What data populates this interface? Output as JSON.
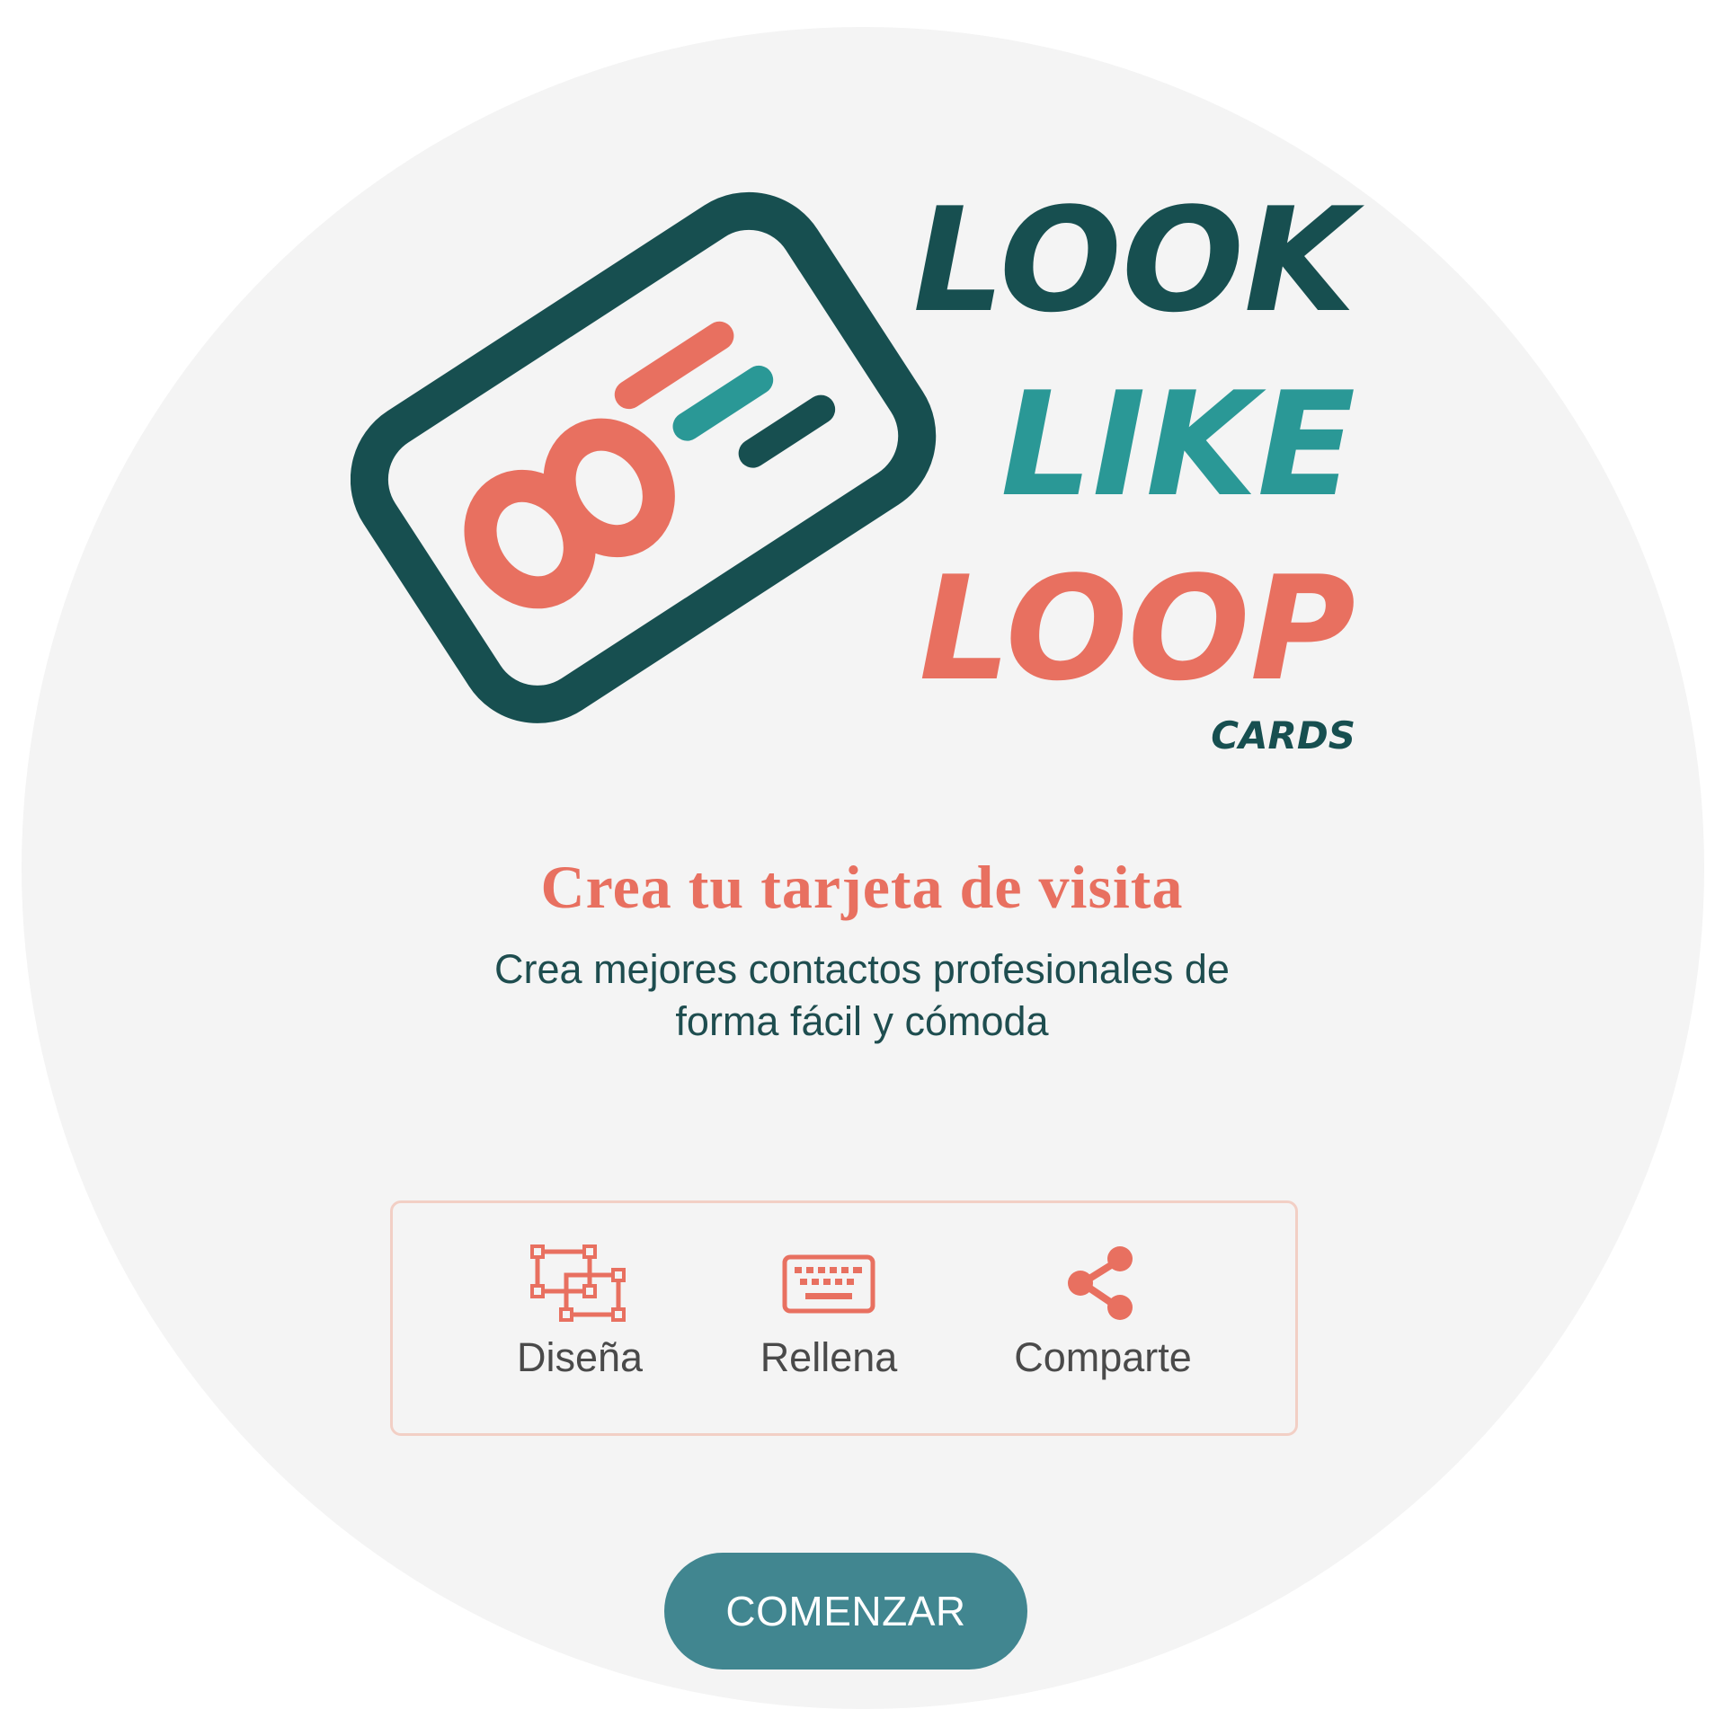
{
  "brand": {
    "logo_words": [
      "LOOK",
      "LIKE",
      "LOOP"
    ],
    "logo_tagline": "CARDS",
    "colors": {
      "dark_teal": "#174f50",
      "teal": "#2a9896",
      "coral": "#e87060"
    }
  },
  "hero": {
    "title": "Crea tu tarjeta de visita",
    "subtitle_line1": "Crea mejores contactos profesionales de",
    "subtitle_line2": "forma fácil y cómoda"
  },
  "steps": [
    {
      "icon": "design-selection-icon",
      "label": "Diseña"
    },
    {
      "icon": "keyboard-icon",
      "label": "Rellena"
    },
    {
      "icon": "share-icon",
      "label": "Comparte"
    }
  ],
  "cta": {
    "label": "COMENZAR",
    "color": "#418690"
  },
  "colors": {
    "background": "#f4f4f4",
    "accent": "#e87060",
    "text_dark": "#1e4d4f",
    "step_border": "#f2cfc5"
  }
}
